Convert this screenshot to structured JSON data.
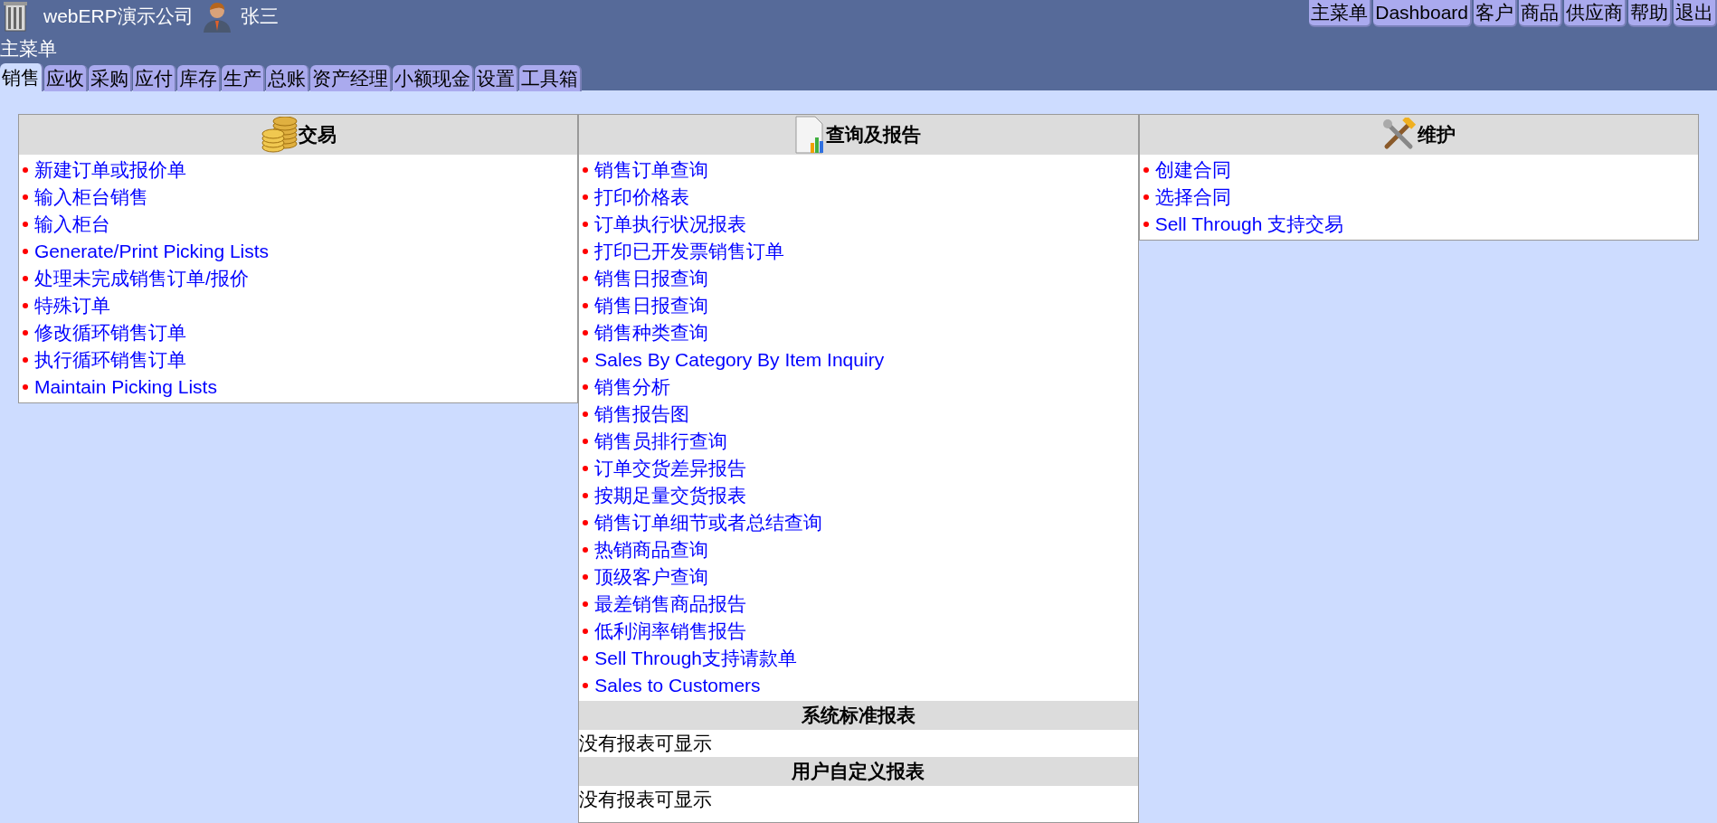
{
  "company": "webERP演示公司",
  "user": "张三",
  "page_title": "主菜单",
  "top_nav": [
    "主菜单",
    "Dashboard",
    "客户",
    "商品",
    "供应商",
    "帮助",
    "退出"
  ],
  "module_tabs": [
    {
      "label": "销售",
      "selected": true
    },
    {
      "label": "应收",
      "selected": false
    },
    {
      "label": "采购",
      "selected": false
    },
    {
      "label": "应付",
      "selected": false
    },
    {
      "label": "库存",
      "selected": false
    },
    {
      "label": "生产",
      "selected": false
    },
    {
      "label": "总账",
      "selected": false
    },
    {
      "label": "资产经理",
      "selected": false
    },
    {
      "label": "小额现金",
      "selected": false
    },
    {
      "label": "设置",
      "selected": false
    },
    {
      "label": "工具箱",
      "selected": false
    }
  ],
  "panels": [
    {
      "title": "交易",
      "links": [
        "新建订单或报价单",
        "输入柜台销售",
        "输入柜台",
        "Generate/Print Picking Lists",
        "处理未完成销售订单/报价",
        "特殊订单",
        "修改循环销售订单",
        "执行循环销售订单",
        "Maintain Picking Lists"
      ]
    },
    {
      "title": "查询及报告",
      "links": [
        "销售订单查询",
        "打印价格表",
        "订单执行状况报表",
        "打印已开发票销售订单",
        "销售日报查询",
        "销售日报查询",
        "销售种类查询",
        "Sales By Category By Item Inquiry",
        "销售分析",
        "销售报告图",
        "销售员排行查询",
        "订单交货差异报告",
        "按期足量交货报表",
        "销售订单细节或者总结查询",
        "热销商品查询",
        "顶级客户查询",
        "最差销售商品报告",
        "低利润率销售报告",
        "Sell Through支持请款单",
        "Sales to Customers"
      ],
      "sections": [
        {
          "title": "系统标准报表",
          "text": "没有报表可显示"
        },
        {
          "title": "用户自定义报表",
          "text": "没有报表可显示"
        }
      ]
    },
    {
      "title": "维护",
      "links": [
        "创建合同",
        "选择合同",
        "Sell Through 支持交易"
      ]
    }
  ]
}
